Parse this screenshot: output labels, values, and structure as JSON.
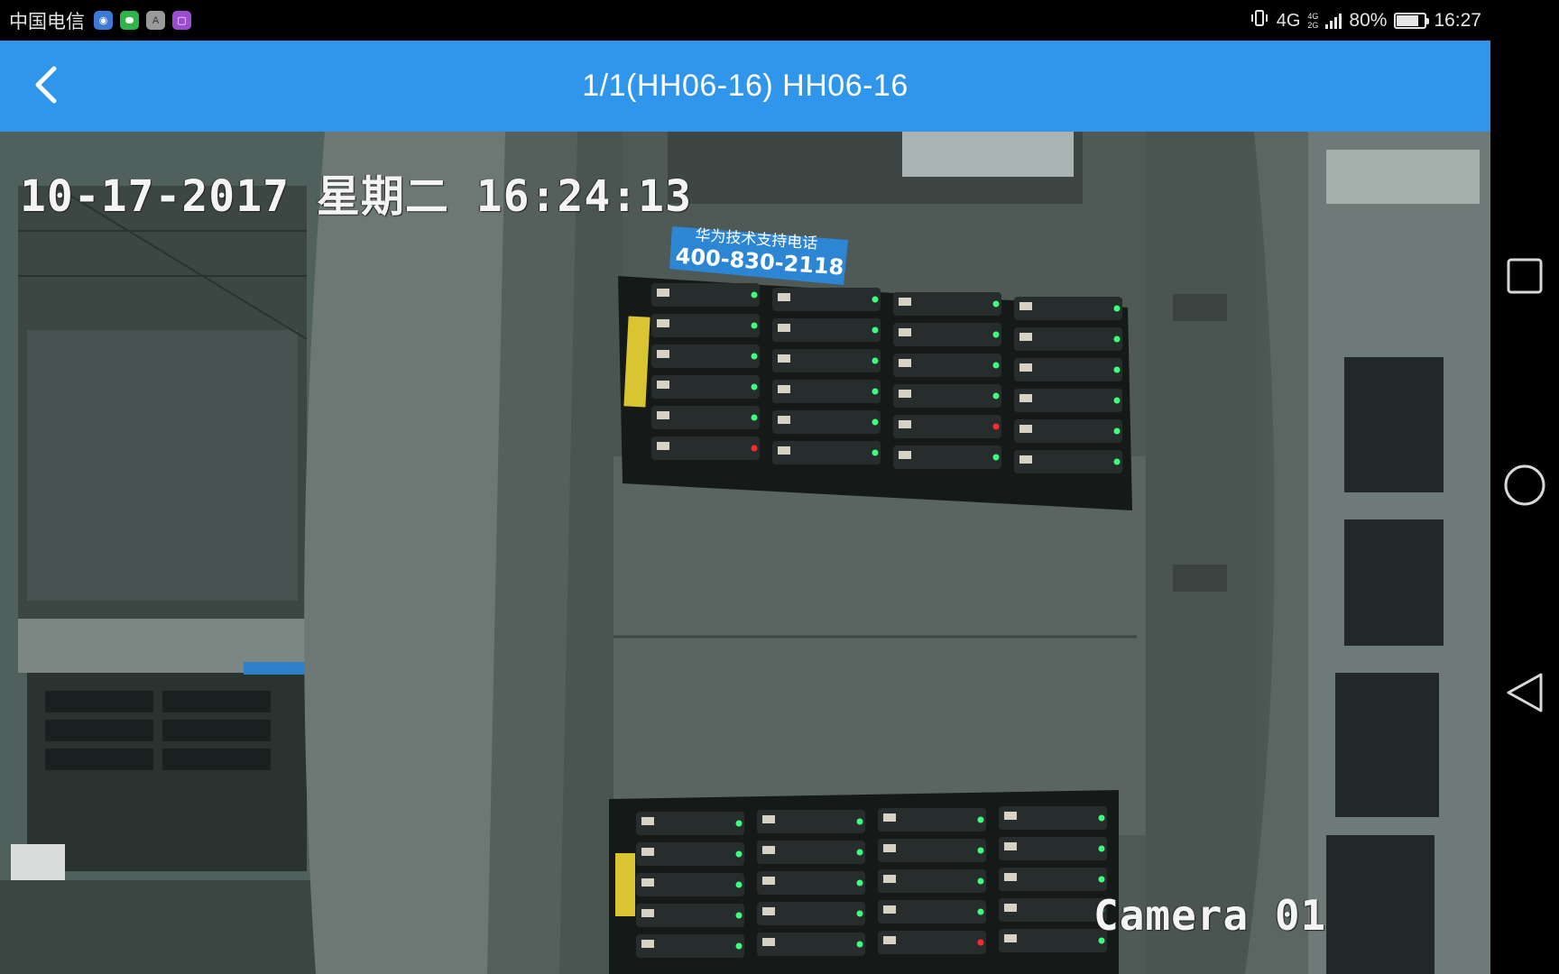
{
  "status_bar": {
    "carrier": "中国电信",
    "app_icons": [
      "blue-app-icon",
      "chat-icon",
      "font-app-icon",
      "gallery-icon"
    ],
    "font_app_letter": "A",
    "network_type": "4G",
    "network_sub_top": "4G",
    "network_sub_bottom": "2G",
    "battery_percent": "80%",
    "battery_level": 0.8,
    "time": "16:27"
  },
  "title_bar": {
    "title": "1/1(HH06-16)  HH06-16",
    "back_icon": "chevron-left-icon",
    "background_color": "#2f96ec"
  },
  "video": {
    "osd_timestamp": "10-17-2017 星期二 16:24:13",
    "camera_label": "Camera 01",
    "sticker_line1": "华为技术支持电话",
    "sticker_line2": "400-830-2118"
  },
  "nav_bar": {
    "buttons": [
      "recent-apps-icon",
      "home-icon",
      "back-triangle-icon"
    ]
  }
}
